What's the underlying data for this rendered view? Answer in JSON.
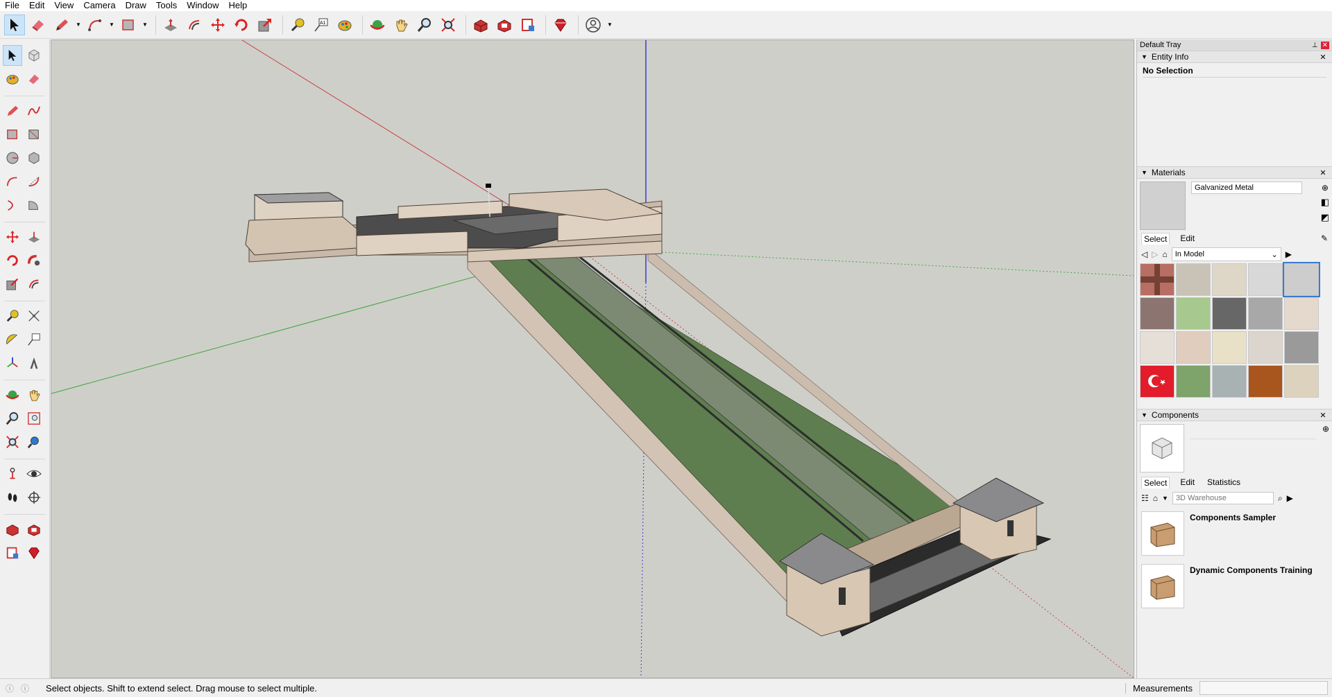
{
  "menubar": {
    "items": [
      "File",
      "Edit",
      "View",
      "Camera",
      "Draw",
      "Tools",
      "Window",
      "Help"
    ]
  },
  "tray": {
    "title": "Default Tray",
    "entity_info": {
      "title": "Entity Info",
      "selection": "No Selection"
    },
    "materials": {
      "title": "Materials",
      "current_name": "Galvanized Metal",
      "tabs": [
        "Select",
        "Edit"
      ],
      "collection": "In Model",
      "swatches": [
        {
          "name": "brick-pattern-red",
          "color": "#b86e62"
        },
        {
          "name": "decorative-tile",
          "color": "#c9c2b6"
        },
        {
          "name": "beige-plain",
          "color": "#ded6c6"
        },
        {
          "name": "light-gray-stripe",
          "color": "#d8d8d8"
        },
        {
          "name": "galvanized-metal",
          "color": "#cdcdcd"
        },
        {
          "name": "brick-brown",
          "color": "#8c7571"
        },
        {
          "name": "green-tile",
          "color": "#a7c98f"
        },
        {
          "name": "dark-gray",
          "color": "#676767"
        },
        {
          "name": "concrete-gray",
          "color": "#a8a8a8"
        },
        {
          "name": "cream-stone",
          "color": "#e4d9cc"
        },
        {
          "name": "pale-stone",
          "color": "#e6dfd8"
        },
        {
          "name": "sand-pillar",
          "color": "#e0cdbd"
        },
        {
          "name": "cream-block",
          "color": "#e8e1c8"
        },
        {
          "name": "marble-light",
          "color": "#dcd5cd"
        },
        {
          "name": "granite-gray",
          "color": "#9a9a9a"
        },
        {
          "name": "turkish-flag",
          "color": "#e21c2a"
        },
        {
          "name": "camouflage-green",
          "color": "#7ea36b"
        },
        {
          "name": "glass-blue-gray",
          "color": "#a8b2b3"
        },
        {
          "name": "wood-brown",
          "color": "#a9551e"
        },
        {
          "name": "light-wood",
          "color": "#ddd2bd"
        }
      ]
    },
    "components": {
      "title": "Components",
      "tabs": [
        "Select",
        "Edit",
        "Statistics"
      ],
      "search_placeholder": "3D Warehouse",
      "items": [
        {
          "name": "Components Sampler"
        },
        {
          "name": "Dynamic Components Training"
        }
      ]
    }
  },
  "status": {
    "message": "Select objects. Shift to extend select. Drag mouse to select multiple.",
    "measurements_label": "Measurements",
    "measurements_value": ""
  },
  "colors": {
    "viewport_bg": "#cfcfca",
    "red_axis": "#c84040",
    "green_axis": "#3da53d",
    "blue_axis": "#3a3ad0",
    "grass": "#5f7e4f",
    "stone": "#d4c6b8",
    "roof": "#8a8a8c"
  }
}
